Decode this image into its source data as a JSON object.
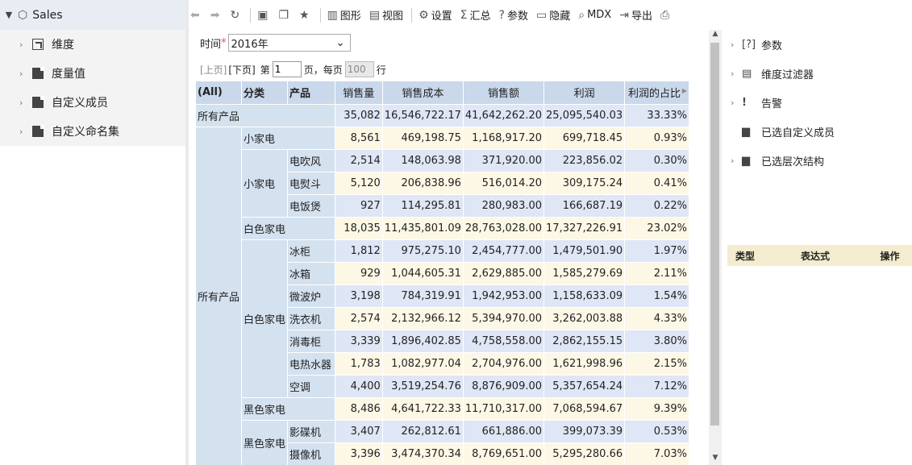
{
  "left_tree": {
    "root": "Sales",
    "items": [
      {
        "label": "维度",
        "icon": "dimension-icon"
      },
      {
        "label": "度量值",
        "icon": "measure-icon"
      },
      {
        "label": "自定义成员",
        "icon": "custom-member-icon"
      },
      {
        "label": "自定义命名集",
        "icon": "named-set-icon"
      }
    ]
  },
  "toolbar": {
    "chart": "图形",
    "view": "视图",
    "settings": "设置",
    "summary": "汇总",
    "params": "参数",
    "hide": "隐藏",
    "mdx": "MDX",
    "export": "导出"
  },
  "filter": {
    "label": "时间",
    "required": "*",
    "value": "2016年"
  },
  "pager": {
    "prev": "[上页]",
    "next": "[下页]",
    "page_prefix": "第",
    "page_value": "1",
    "page_suffix": "页，每页",
    "per_page": "100",
    "rows_suffix": "行"
  },
  "grid": {
    "headers": {
      "all": "(All)",
      "category": "分类",
      "product": "产品"
    },
    "measures": [
      "销售量",
      "销售成本",
      "销售额",
      "利润",
      "利润的占比"
    ],
    "rows": [
      {
        "l1": "所有产品",
        "vals": [
          "35,082",
          "16,546,722.17",
          "41,642,262.20",
          "25,095,540.03",
          "33.33%"
        ]
      },
      {
        "l2": "小家电",
        "vals": [
          "8,561",
          "469,198.75",
          "1,168,917.20",
          "699,718.45",
          "0.93%"
        ]
      },
      {
        "l3": "电吹风",
        "vals": [
          "2,514",
          "148,063.98",
          "371,920.00",
          "223,856.02",
          "0.30%"
        ]
      },
      {
        "l3": "电熨斗",
        "vals": [
          "5,120",
          "206,838.96",
          "516,014.20",
          "309,175.24",
          "0.41%"
        ]
      },
      {
        "l3": "电饭煲",
        "vals": [
          "927",
          "114,295.81",
          "280,983.00",
          "166,687.19",
          "0.22%"
        ]
      },
      {
        "l2": "白色家电",
        "vals": [
          "18,035",
          "11,435,801.09",
          "28,763,028.00",
          "17,327,226.91",
          "23.02%"
        ]
      },
      {
        "l3": "冰柜",
        "vals": [
          "1,812",
          "975,275.10",
          "2,454,777.00",
          "1,479,501.90",
          "1.97%"
        ]
      },
      {
        "l3": "冰箱",
        "vals": [
          "929",
          "1,044,605.31",
          "2,629,885.00",
          "1,585,279.69",
          "2.11%"
        ]
      },
      {
        "l3": "微波炉",
        "vals": [
          "3,198",
          "784,319.91",
          "1,942,953.00",
          "1,158,633.09",
          "1.54%"
        ]
      },
      {
        "l3": "洗衣机",
        "vals": [
          "2,574",
          "2,132,966.12",
          "5,394,970.00",
          "3,262,003.88",
          "4.33%"
        ]
      },
      {
        "l3": "消毒柜",
        "vals": [
          "3,339",
          "1,896,402.85",
          "4,758,558.00",
          "2,862,155.15",
          "3.80%"
        ]
      },
      {
        "l3": "电热水器",
        "vals": [
          "1,783",
          "1,082,977.04",
          "2,704,976.00",
          "1,621,998.96",
          "2.15%"
        ]
      },
      {
        "l3": "空调",
        "vals": [
          "4,400",
          "3,519,254.76",
          "8,876,909.00",
          "5,357,654.24",
          "7.12%"
        ]
      },
      {
        "l2": "黑色家电",
        "vals": [
          "8,486",
          "4,641,722.33",
          "11,710,317.00",
          "7,068,594.67",
          "9.39%"
        ]
      },
      {
        "l3": "影碟机",
        "vals": [
          "3,407",
          "262,812.61",
          "661,886.00",
          "399,073.39",
          "0.53%"
        ]
      },
      {
        "l3": "摄像机",
        "vals": [
          "3,396",
          "3,474,370.34",
          "8,769,651.00",
          "5,295,280.66",
          "7.03%"
        ]
      }
    ],
    "spans": {
      "all_products_l1": "所有产品",
      "xjd_l2": "小家电",
      "bsjd_l2": "白色家电",
      "hsjd_l2": "黑色家电"
    }
  },
  "right_panel": {
    "items": [
      {
        "label": "参数",
        "icon": "param-icon"
      },
      {
        "label": "维度过滤器",
        "icon": "filter-icon"
      },
      {
        "label": "告警",
        "icon": "alert-icon"
      },
      {
        "label": "已选自定义成员",
        "icon": "selected-member-icon"
      },
      {
        "label": "已选层次结构",
        "icon": "hierarchy-icon"
      }
    ],
    "expr_table": {
      "type": "类型",
      "expr": "表达式",
      "op": "操作"
    }
  }
}
